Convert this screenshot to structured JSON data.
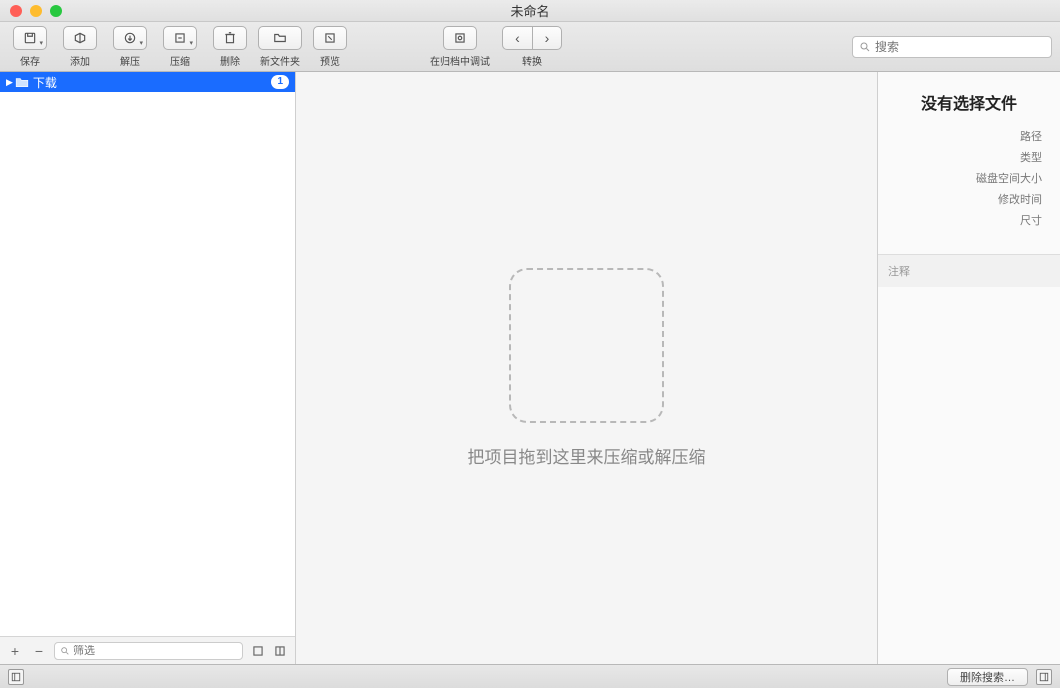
{
  "window": {
    "title": "未命名"
  },
  "toolbar": {
    "save": "保存",
    "add": "添加",
    "unzip": "解压",
    "compress": "压缩",
    "delete": "删除",
    "newfolder": "新文件夹",
    "preview": "预览",
    "fitmode": "在归档中调试",
    "convert": "转换"
  },
  "search": {
    "placeholder": "搜索"
  },
  "sidebar": {
    "items": [
      {
        "label": "下载",
        "badge": "1"
      }
    ],
    "filter_placeholder": "筛选"
  },
  "content": {
    "drop_hint": "把项目拖到这里来压缩或解压缩"
  },
  "inspector": {
    "title": "没有选择文件",
    "fields": [
      "路径",
      "类型",
      "磁盘空间大小",
      "修改时间",
      "尺寸"
    ],
    "note_label": "注释"
  },
  "statusbar": {
    "delete_search": "删除搜索…"
  }
}
